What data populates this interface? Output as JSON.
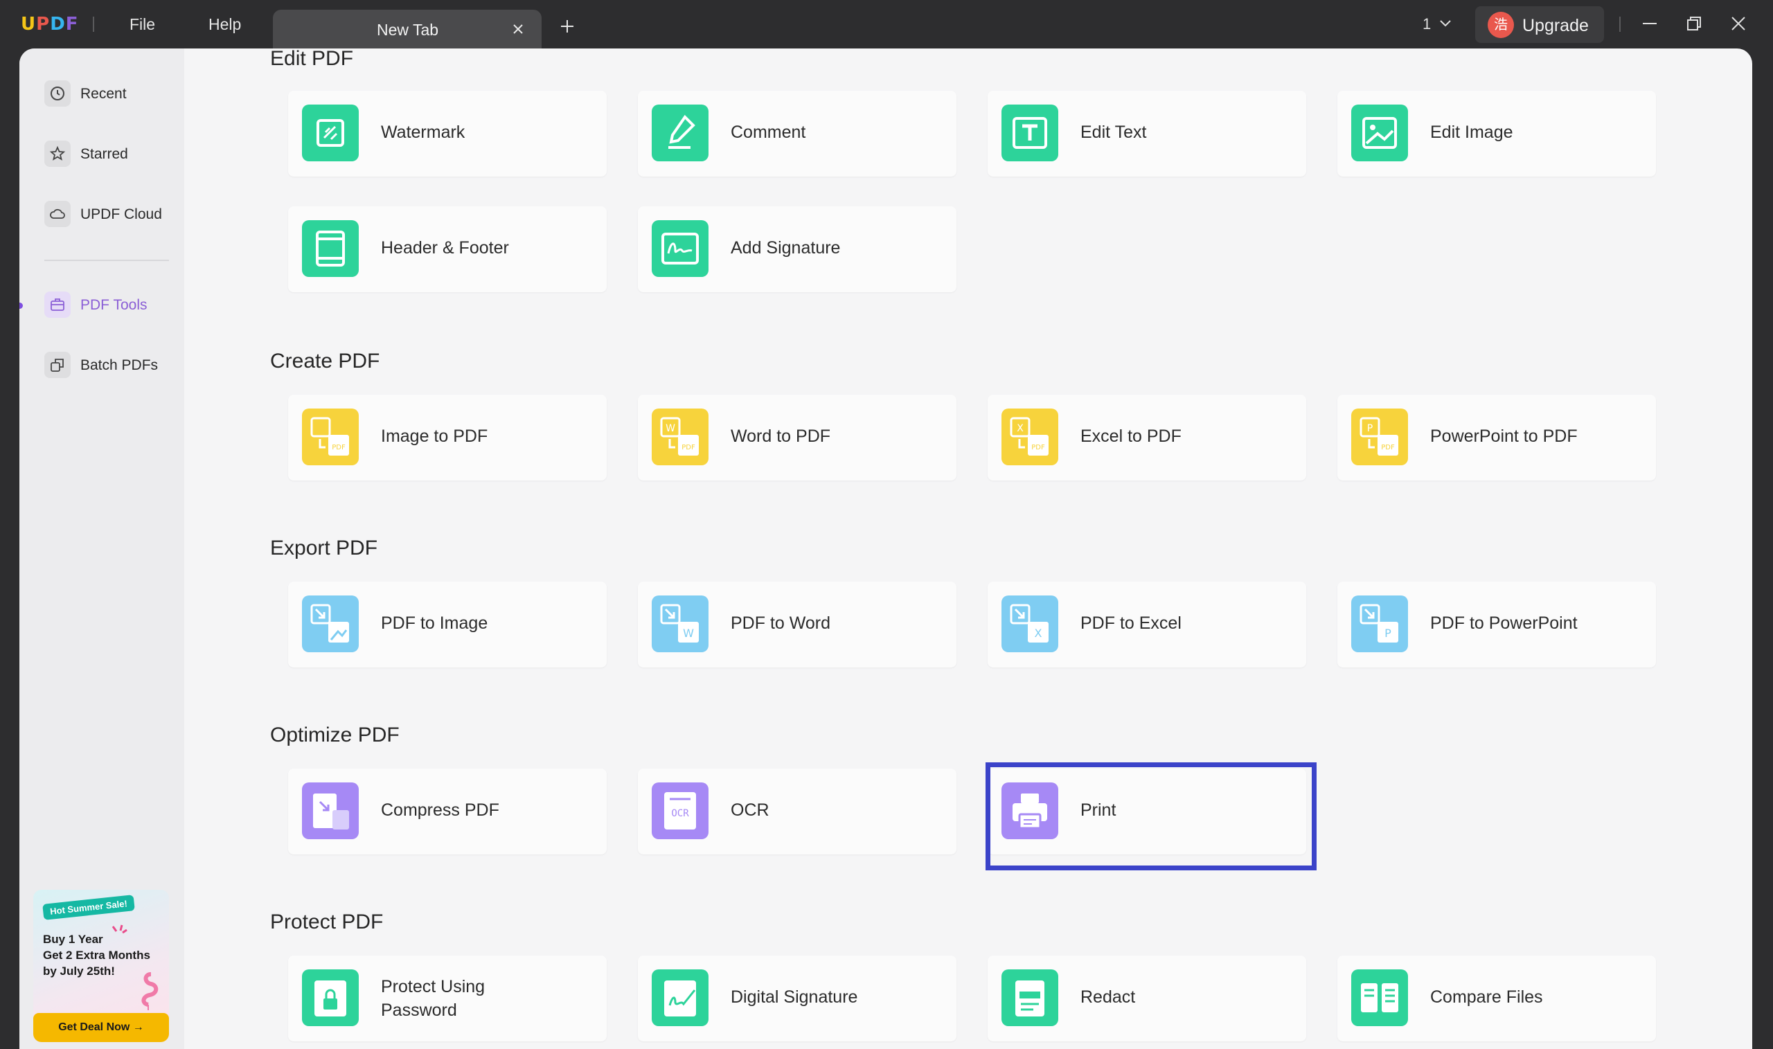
{
  "app": {
    "logo": "UPDF"
  },
  "menu": {
    "file": "File",
    "help": "Help"
  },
  "tab": {
    "title": "New Tab"
  },
  "page_indicator": "1",
  "upgrade": {
    "label": "Upgrade",
    "avatar_char": "浩"
  },
  "sidebar": {
    "items": [
      {
        "label": "Recent",
        "icon": "clock-icon"
      },
      {
        "label": "Starred",
        "icon": "star-icon"
      },
      {
        "label": "UPDF Cloud",
        "icon": "cloud-icon"
      },
      {
        "label": "PDF Tools",
        "icon": "toolbox-icon",
        "active": true
      },
      {
        "label": "Batch PDFs",
        "icon": "batch-icon"
      }
    ],
    "promo": {
      "badge": "Hot Summer Sale!",
      "line1": "Buy 1 Year",
      "line2": "Get 2 Extra Months",
      "line3": "by July 25th!",
      "button": "Get Deal Now"
    }
  },
  "sections": {
    "edit": {
      "title": "Edit PDF",
      "items": [
        "Watermark",
        "Comment",
        "Edit Text",
        "Edit Image",
        "Header & Footer",
        "Add Signature"
      ]
    },
    "create": {
      "title": "Create PDF",
      "items": [
        "Image to PDF",
        "Word to PDF",
        "Excel to PDF",
        "PowerPoint to PDF"
      ]
    },
    "export": {
      "title": "Export PDF",
      "items": [
        "PDF to Image",
        "PDF to Word",
        "PDF to Excel",
        "PDF to PowerPoint"
      ]
    },
    "optimize": {
      "title": "Optimize PDF",
      "items": [
        "Compress PDF",
        "OCR",
        "Print"
      ]
    },
    "protect": {
      "title": "Protect PDF",
      "items": [
        "Protect Using",
        "Password",
        "Digital Signature",
        "Redact",
        "Compare Files"
      ]
    }
  },
  "colors": {
    "edit_green": "#2dd39a",
    "create_yellow": "#f7d33c",
    "export_blue": "#7fcdf2",
    "optimize_purple": "#a689f5",
    "highlight_border": "#3b43c9",
    "accent_purple": "#8b5fd6"
  }
}
